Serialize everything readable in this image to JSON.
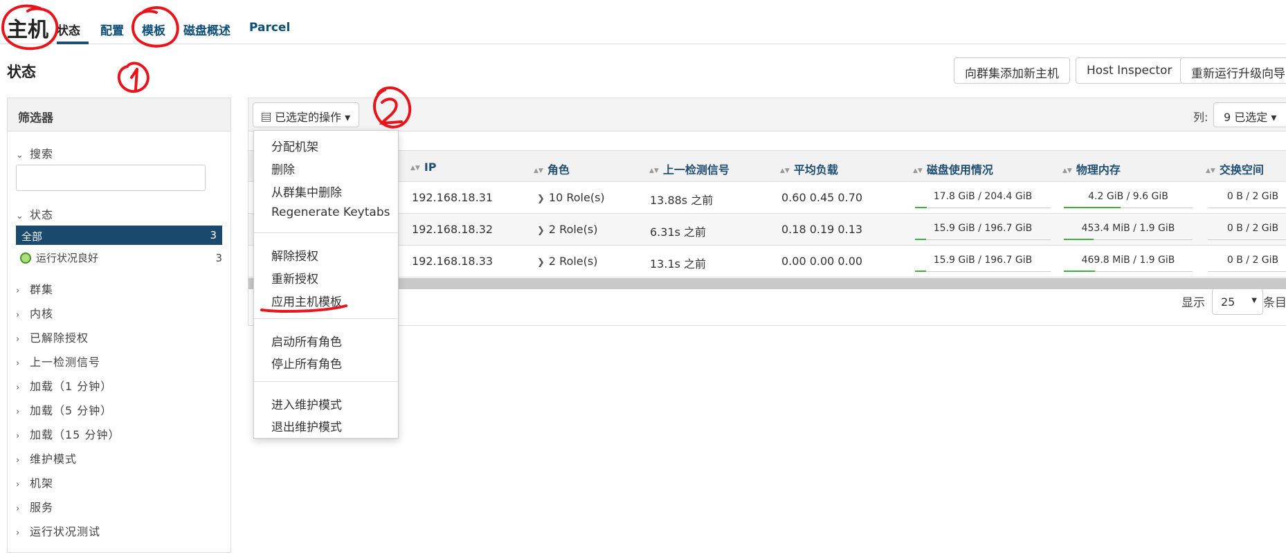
{
  "nav": {
    "brand": "主机",
    "tabs": [
      "状态",
      "配置",
      "模板",
      "磁盘概述",
      "Parcel"
    ]
  },
  "page": {
    "title": "状态",
    "buttons": [
      "向群集添加新主机",
      "Host Inspector",
      "重新运行升级向导"
    ]
  },
  "sidebar": {
    "header": "筛选器",
    "search_label": "搜索",
    "status_label": "状态",
    "all_label": "全部",
    "all_count": "3",
    "good_label": "运行状况良好",
    "good_count": "3",
    "sections": [
      "群集",
      "内核",
      "已解除授权",
      "上一检测信号",
      "加载（1 分钟）",
      "加载（5 分钟）",
      "加载（15 分钟）",
      "维护模式",
      "机架",
      "服务",
      "运行状况测试"
    ]
  },
  "toolbar": {
    "actions_label": "已选定的操作",
    "columns_label": "列:",
    "columns_value": "9 已选定"
  },
  "table": {
    "headers": [
      "IP",
      "角色",
      "上一检测信号",
      "平均负载",
      "磁盘使用情况",
      "物理内存",
      "交换空间"
    ],
    "rows": [
      {
        "ip": "192.168.18.31",
        "roles": "10 Role(s)",
        "heartbeat": "13.88s 之前",
        "load": "0.60  0.45  0.70",
        "disk": "17.8 GiB / 204.4 GiB",
        "disk_frac": 0.087,
        "mem": "4.2 GiB / 9.6 GiB",
        "mem_frac": 0.44,
        "swap": "0 B / 2 GiB"
      },
      {
        "ip": "192.168.18.32",
        "roles": "2 Role(s)",
        "heartbeat": "6.31s 之前",
        "load": "0.18  0.19  0.13",
        "disk": "15.9 GiB / 196.7 GiB",
        "disk_frac": 0.081,
        "mem": "453.4 MiB / 1.9 GiB",
        "mem_frac": 0.23,
        "swap": "0 B / 2 GiB"
      },
      {
        "ip": "192.168.18.33",
        "roles": "2 Role(s)",
        "heartbeat": "13.1s 之前",
        "load": "0.00  0.00  0.00",
        "disk": "15.9 GiB / 196.7 GiB",
        "disk_frac": 0.081,
        "mem": "469.8 MiB / 1.9 GiB",
        "mem_frac": 0.24,
        "swap": "0 B / 2 GiB"
      }
    ]
  },
  "pagination": {
    "show_label": "显示",
    "page_size": "25",
    "per_page_label": "条目"
  },
  "dropdown": {
    "items": [
      "分配机架",
      "删除",
      "从群集中删除",
      "Regenerate Keytabs",
      "解除授权",
      "重新授权",
      "应用主机模板",
      "启动所有角色",
      "停止所有角色",
      "进入维护模式",
      "退出维护模式"
    ]
  },
  "colors": {
    "accent": "#1a4a6e",
    "link": "#0e4f7a",
    "ok": "#3fae3f",
    "annotation": "#e8141b"
  }
}
